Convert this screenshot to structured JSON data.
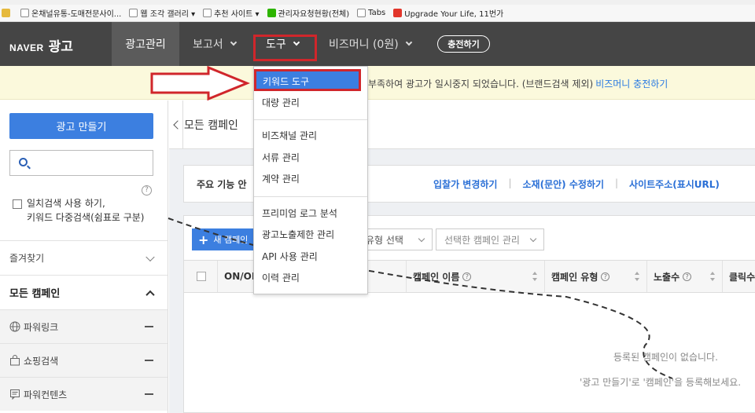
{
  "colors": {
    "nav_bg": "#454545",
    "accent": "#3c7fe0",
    "link": "#2a6fd6",
    "highlight_red": "#d0262b",
    "notice_bg": "#fbf9dc"
  },
  "bookmarks": [
    {
      "label": "온채널유통-도매전문사이...",
      "icon": "page-icon"
    },
    {
      "label": "웹 조각 갤러리 ▾",
      "icon": "page-icon"
    },
    {
      "label": "추천 사이트 ▾",
      "icon": "page-icon"
    },
    {
      "label": "관리자요청현황(전체)",
      "icon": "naver-icon"
    },
    {
      "label": "Tabs",
      "icon": "page-icon"
    },
    {
      "label": "Upgrade Your Life, 11번가",
      "icon": "11st-icon"
    }
  ],
  "nav": {
    "logo_brand": "NAVER",
    "logo_product": "광고",
    "ad_manage": "광고관리",
    "report": "보고서",
    "tools": "도구",
    "biz_money": "비즈머니 (0원)",
    "charge": "충전하기"
  },
  "notice": {
    "text": "부족하여 광고가 일시중지 되었습니다. (브랜드검색 제외)",
    "link": "비즈머니 충전하기"
  },
  "tools_menu": {
    "group1": [
      "키워드 도구",
      "대량 관리"
    ],
    "group2": [
      "비즈채널 관리",
      "서류 관리",
      "계약 관리"
    ],
    "group3": [
      "프리미엄 로그 분석",
      "광고노출제한 관리",
      "API 사용 관리",
      "이력 관리"
    ]
  },
  "sidebar": {
    "create_ad": "광고 만들기",
    "search_placeholder": "",
    "help": "?",
    "exact_line1": "일치검색 사용 하기,",
    "exact_line2": "키워드 다중검색(쉼표로 구분)",
    "favorites": "즐겨찾기",
    "all_campaigns": "모든 캠페인",
    "campaign_types": [
      {
        "label": "파워링크",
        "icon": "globe-icon"
      },
      {
        "label": "쇼핑검색",
        "icon": "shopping-bag-icon"
      },
      {
        "label": "파워컨텐츠",
        "icon": "content-icon"
      }
    ]
  },
  "main": {
    "title": "모든 캠페인",
    "feature_label": "주요 기능 안",
    "feature_links": [
      "입찰가 변경하기",
      "소재(문안) 수정하기",
      "사이트주소(표시URL)"
    ],
    "new_campaign": "새 캠페인",
    "type_select": "유형 선택",
    "manage_select": "선택한 캠페인 관리",
    "columns": [
      "ON/OFF",
      "캠페인 이름",
      "캠페인 유형",
      "노출수",
      "클릭수"
    ],
    "empty_line1": "등록된 캠페인이 없습니다.",
    "empty_line2": "'광고 만들기'로 '캠페인'을 등록해보세요."
  }
}
